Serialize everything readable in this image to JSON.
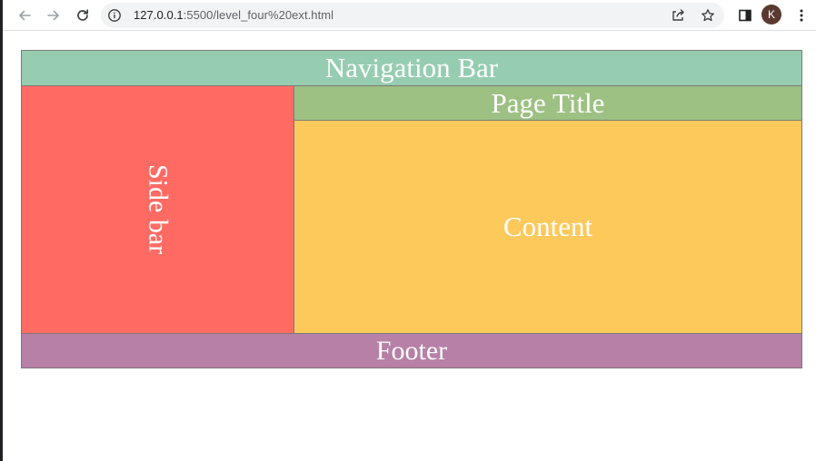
{
  "browser": {
    "url_host": "127.0.0.1",
    "url_path": ":5500/level_four%20ext.html",
    "profile_initial": "K",
    "icons": {
      "back": "arrow-left-icon",
      "forward": "arrow-right-icon",
      "reload": "reload-icon",
      "site_info": "info-icon",
      "share": "share-icon",
      "bookmark": "star-icon",
      "side_panel": "side-panel-icon",
      "menu": "three-dot-menu-icon"
    }
  },
  "layout_blocks": {
    "navbar": {
      "label": "Navigation Bar",
      "color": "#96cdb0"
    },
    "sidebar": {
      "label": "Side bar",
      "color": "#ff6b63"
    },
    "page_title": {
      "label": "Page Title",
      "color": "#9dc083"
    },
    "content": {
      "label": "Content",
      "color": "#fdc95b"
    },
    "footer": {
      "label": "Footer",
      "color": "#b680a7"
    }
  }
}
